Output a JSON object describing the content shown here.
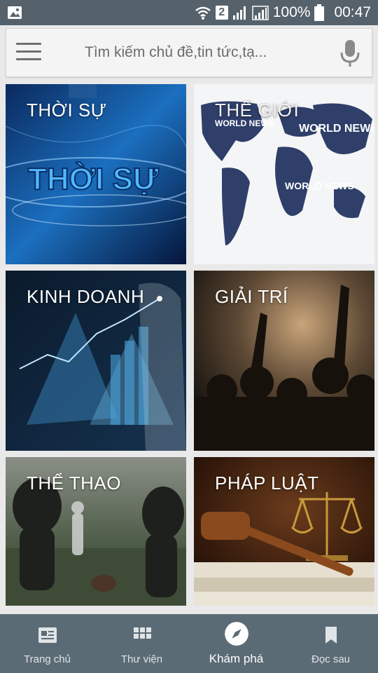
{
  "status_bar": {
    "sim_slot": "2",
    "battery": "100%",
    "time": "00:47",
    "icons": [
      "image-notification-icon",
      "wifi-icon",
      "signal-icon",
      "battery-icon"
    ]
  },
  "search": {
    "placeholder": "Tìm kiếm chủ đề,tin tức,tạ..."
  },
  "categories": [
    {
      "label": "THỜI SỰ",
      "banner_text": "THỜI SỰ"
    },
    {
      "label": "THẾ GIỚI",
      "banner_text": "WORLD NEWS"
    },
    {
      "label": "KINH DOANH"
    },
    {
      "label": "GIẢI TRÍ"
    },
    {
      "label": "THỂ THAO"
    },
    {
      "label": "PHÁP LUẬT"
    }
  ],
  "bottom_nav": {
    "items": [
      {
        "label": "Trang chủ",
        "icon": "newspaper-icon"
      },
      {
        "label": "Thư viện",
        "icon": "grid-icon"
      },
      {
        "label": "Khám phá",
        "icon": "compass-icon",
        "active": true
      },
      {
        "label": "Đọc sau",
        "icon": "bookmark-icon"
      }
    ]
  },
  "colors": {
    "status_bar": "#56626b",
    "bottom_nav": "#5b6b75",
    "background": "#e9e9e9"
  }
}
